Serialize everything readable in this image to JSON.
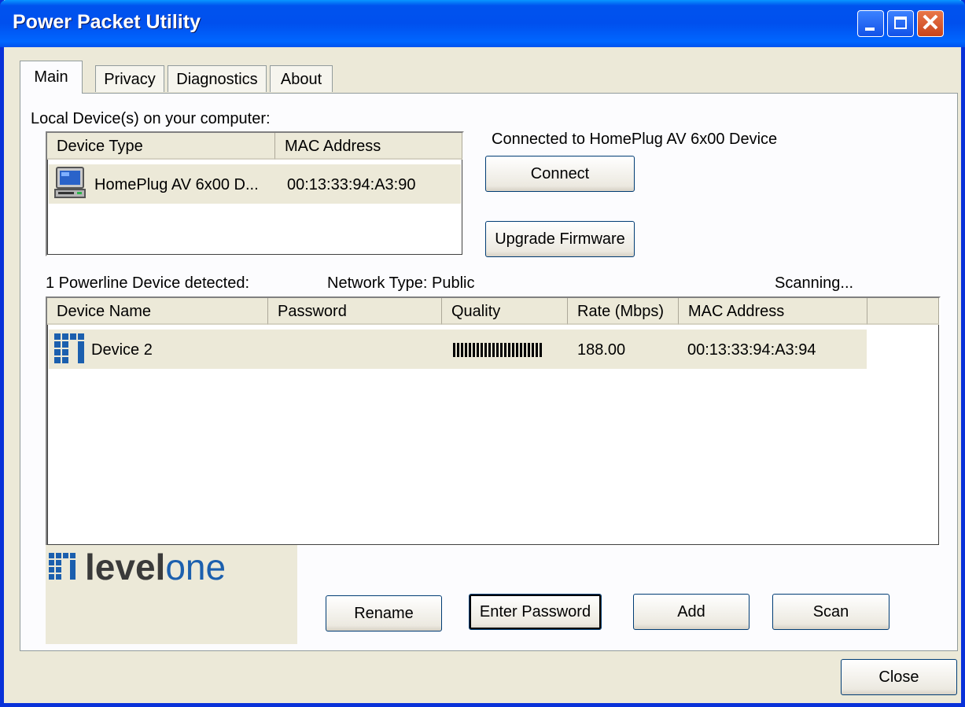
{
  "window": {
    "title": "Power Packet Utility"
  },
  "tabs": [
    {
      "label": "Main"
    },
    {
      "label": "Privacy"
    },
    {
      "label": "Diagnostics"
    },
    {
      "label": "About"
    }
  ],
  "local": {
    "label": "Local Device(s) on your computer:",
    "columns": [
      "Device Type",
      "MAC Address"
    ],
    "rows": [
      {
        "device_type": "HomePlug AV 6x00 D...",
        "mac": "00:13:33:94:A3:90",
        "icon": "computer-icon"
      }
    ]
  },
  "connection": {
    "status": "Connected to HomePlug AV 6x00 Device",
    "connect_label": "Connect",
    "upgrade_label": "Upgrade Firmware"
  },
  "powerline": {
    "detected": "1 Powerline Device detected:",
    "network_type": "Network Type: Public",
    "scanning": "Scanning...",
    "columns": [
      "Device Name",
      "Password",
      "Quality",
      "Rate (Mbps)",
      "MAC Address"
    ],
    "rows": [
      {
        "name": "Device 2",
        "password": "",
        "quality_icon": "signal-bars-icon",
        "rate": "188.00",
        "mac": "00:13:33:94:A3:94",
        "icon": "levelone-device-icon"
      }
    ]
  },
  "logo": {
    "text": "levelone"
  },
  "actions": {
    "rename": "Rename",
    "enter_password": "Enter Password",
    "add": "Add",
    "scan": "Scan",
    "close": "Close"
  },
  "colors": {
    "title_bar": "#0053ee",
    "window_bg": "#ece9d8",
    "logo_blue": "#1b5fae",
    "logo_grey": "#3a3a3a"
  }
}
